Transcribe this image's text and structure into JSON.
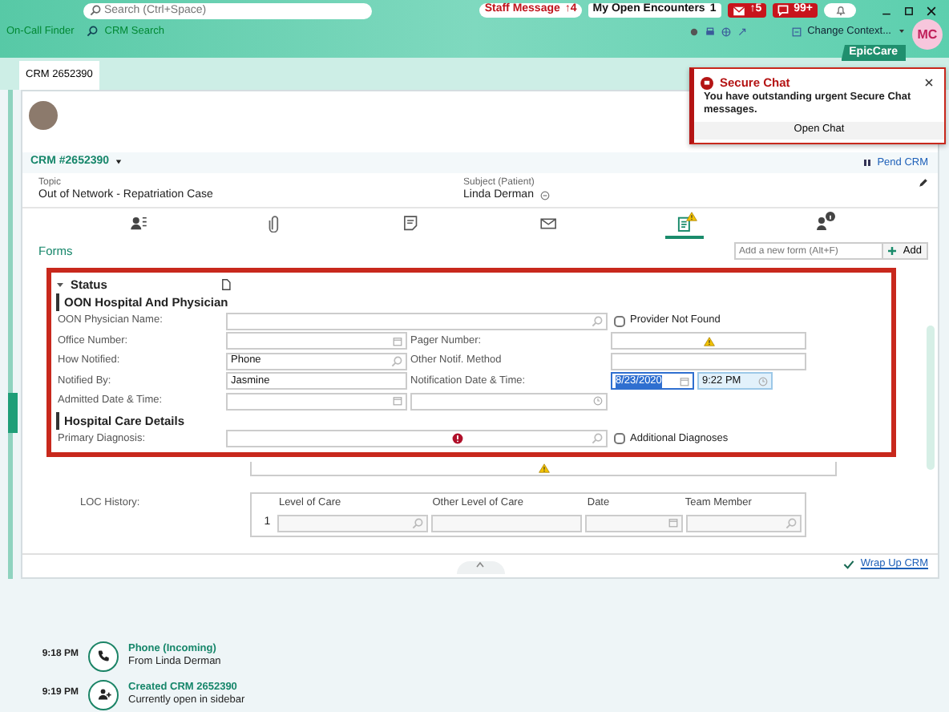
{
  "header": {
    "search": {
      "placeholder": "Search (Ctrl+Space)"
    },
    "badges": [
      {
        "kind": "pill",
        "label": "Staff Message",
        "count": "↑4"
      },
      {
        "kind": "box",
        "label": "My Open Encounters",
        "count": "1"
      },
      {
        "kind": "mail",
        "count": "↑5"
      },
      {
        "kind": "chat",
        "count": "99+"
      }
    ],
    "links": [
      "On-Call Finder",
      "CRM Search"
    ],
    "change_context": "Change Context...",
    "app_label": "EpicCare",
    "user_initials": "MC"
  },
  "tabs": [
    {
      "label": "CRM 2652390",
      "selected": true
    }
  ],
  "secure_chat": {
    "title": "Secure Chat",
    "message": "You have outstanding urgent Secure Chat messages.",
    "button": "Open Chat"
  },
  "crm": {
    "title": "CRM #2652390",
    "pend": "Pend CRM",
    "topic_label": "Topic",
    "topic": "Out of Network - Repatriation Case",
    "subject_label": "Subject (Patient)",
    "subject": "Linda Derman"
  },
  "toolbar": [
    {
      "kind": "contacts",
      "selected": false
    },
    {
      "kind": "attachment",
      "selected": false
    },
    {
      "kind": "note",
      "selected": false
    },
    {
      "kind": "mail",
      "selected": false
    },
    {
      "kind": "form",
      "selected": true,
      "warning": true
    },
    {
      "kind": "person",
      "selected": false,
      "info": true
    }
  ],
  "forms": {
    "title": "Forms",
    "add_placeholder": "Add a new form (Alt+F)",
    "add_button": "Add"
  },
  "status": {
    "title": "Status",
    "expanded": true,
    "groups": [
      {
        "title": "OON Hospital And Physician",
        "rows": [
          {
            "label": "OON Physician Name:",
            "cells": [
              {
                "kind": "lookup-wide"
              }
            ],
            "option": {
              "label": "Provider Not Found",
              "checked": false
            }
          },
          {
            "label": "Office Number:",
            "cells": [
              {
                "kind": "calendar"
              },
              {
                "kind": "label",
                "text": "Pager Number:"
              },
              {
                "kind": "text",
                "warning": true
              }
            ]
          },
          {
            "label": "How Notified:",
            "cells": [
              {
                "kind": "lookup",
                "value": "Phone"
              },
              {
                "kind": "label",
                "text": "Other Notif. Method"
              },
              {
                "kind": "text"
              }
            ]
          },
          {
            "label": "Notified By:",
            "cells": [
              {
                "kind": "text",
                "value": "Jasmine"
              },
              {
                "kind": "label",
                "text": "Notification Date & Time:"
              },
              {
                "kind": "calendar",
                "value": "8/23/2020",
                "selected": true
              },
              {
                "kind": "clock",
                "value": "9:22 PM"
              }
            ]
          },
          {
            "label": "Admitted Date & Time:",
            "cells": [
              {
                "kind": "calendar"
              },
              {
                "kind": "clock"
              }
            ]
          }
        ]
      },
      {
        "title": "Hospital Care Details",
        "rows": [
          {
            "label": "Primary Diagnosis:",
            "cells": [
              {
                "kind": "lookup-wide",
                "error": true
              }
            ],
            "option": {
              "label": "Additional Diagnoses",
              "checked": false
            }
          }
        ]
      }
    ]
  },
  "rationale_field": {
    "warning": true
  },
  "loc_history": {
    "label": "LOC History:",
    "columns": [
      "Level of Care",
      "Other Level of Care",
      "Date",
      "Team Member"
    ],
    "rows": [
      {
        "number": "1"
      }
    ]
  },
  "footer": {
    "wrap_up": "Wrap Up CRM"
  },
  "timeline": [
    {
      "kind": "phone",
      "time": "9:18 PM",
      "title": "Phone (Incoming)",
      "detail": "From Linda Derman"
    },
    {
      "kind": "created",
      "time": "9:19 PM",
      "title": "Created CRM 2652390",
      "detail": "Currently open in sidebar"
    }
  ]
}
